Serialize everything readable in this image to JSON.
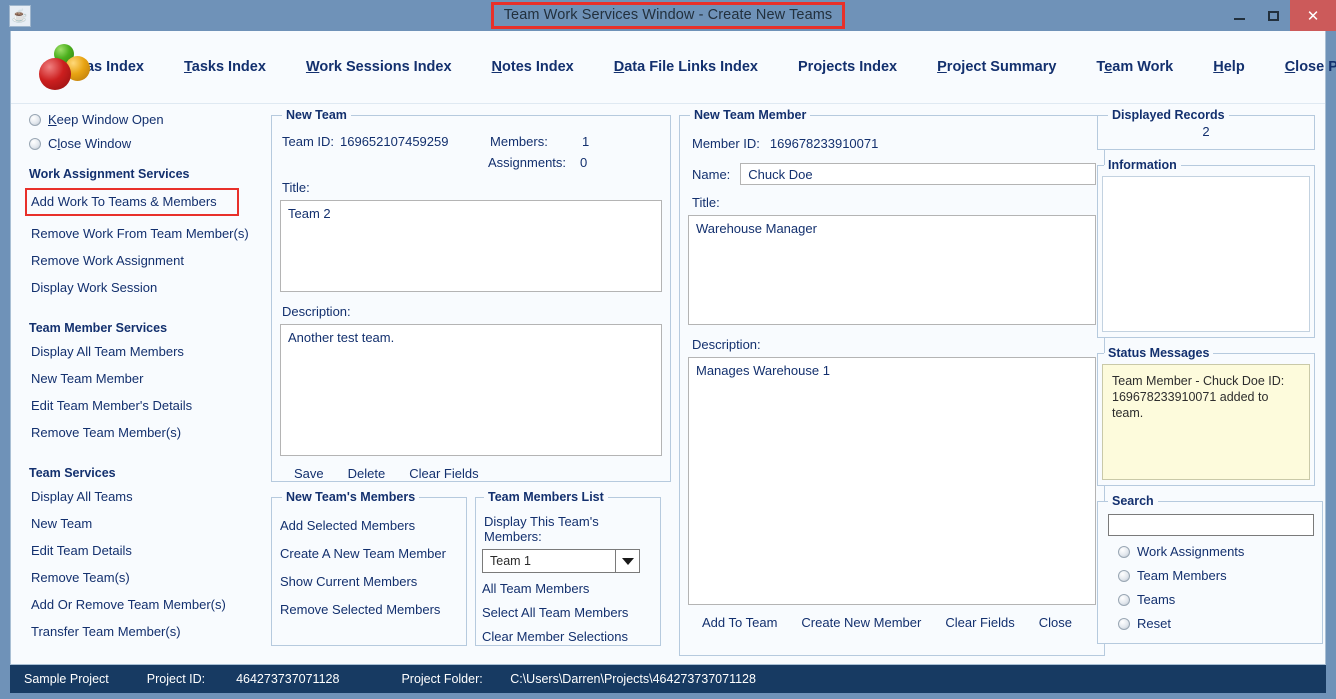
{
  "window": {
    "title": "Team Work Services Window - Create New Teams",
    "app_icon": "java-coffee-cup-icon",
    "minimize": "minimize-icon",
    "maximize": "maximize-icon",
    "close": "✕",
    "highlight_color": "#e8302a",
    "titlebar_color": "#6f92b8",
    "close_button_color": "#cc5a5a"
  },
  "menu": {
    "items": [
      {
        "label": "Ideas Index",
        "mnemonic": "I"
      },
      {
        "label": "Tasks Index",
        "mnemonic": "T"
      },
      {
        "label": "Work Sessions Index",
        "mnemonic": "W"
      },
      {
        "label": "Notes Index",
        "mnemonic": "N"
      },
      {
        "label": "Data File Links Index",
        "mnemonic": "D"
      },
      {
        "label": "Projects Index",
        "mnemonic": ""
      },
      {
        "label": "Project Summary",
        "mnemonic": "P"
      },
      {
        "label": "Team Work",
        "mnemonic": "e"
      },
      {
        "label": "Help",
        "mnemonic": "H"
      },
      {
        "label": "Close Program",
        "mnemonic": "C"
      }
    ]
  },
  "sidebar": {
    "radios": [
      {
        "label": "Keep Window Open",
        "selected": false
      },
      {
        "label": "Close Window",
        "selected": false
      }
    ],
    "groups": [
      {
        "title": "Work Assignment Services",
        "items": [
          {
            "label": "Add Work To Teams & Members",
            "highlighted": true
          },
          {
            "label": "Remove Work From Team Member(s)",
            "highlighted": false
          },
          {
            "label": "Remove Work Assignment",
            "highlighted": false
          },
          {
            "label": "Display Work Session",
            "highlighted": false
          }
        ]
      },
      {
        "title": "Team Member Services",
        "items": [
          {
            "label": "Display All Team Members",
            "highlighted": false
          },
          {
            "label": "New Team Member",
            "highlighted": false
          },
          {
            "label": "Edit Team Member's Details",
            "highlighted": false
          },
          {
            "label": "Remove Team Member(s)",
            "highlighted": false
          }
        ]
      },
      {
        "title": "Team Services",
        "items": [
          {
            "label": "Display All Teams",
            "highlighted": false
          },
          {
            "label": "New Team",
            "highlighted": false
          },
          {
            "label": "Edit Team Details",
            "highlighted": false
          },
          {
            "label": "Remove Team(s)",
            "highlighted": false
          },
          {
            "label": "Add Or Remove Team Member(s)",
            "highlighted": false
          },
          {
            "label": "Transfer Team Member(s)",
            "highlighted": false
          }
        ]
      }
    ]
  },
  "new_team": {
    "legend": "New Team",
    "team_id_label": "Team ID:",
    "team_id_value": "169652107459259",
    "members_label": "Members:",
    "members_value": "1",
    "assignments_label": "Assignments:",
    "assignments_value": "0",
    "title_label": "Title:",
    "title_value": "Team 2",
    "description_label": "Description:",
    "description_value": "Another test team.",
    "buttons": [
      "Save",
      "Delete",
      "Clear Fields"
    ]
  },
  "new_teams_members": {
    "legend": "New Team's Members",
    "items": [
      "Add Selected Members",
      "Create A New Team Member",
      "Show Current Members",
      "Remove Selected Members"
    ]
  },
  "team_members_list": {
    "legend": "Team Members List",
    "combo_label": "Display This Team's Members:",
    "combo_value": "Team 1",
    "combo_icon": "chevron-down-icon",
    "items": [
      "All Team Members",
      "Select All Team Members",
      "Clear Member Selections"
    ]
  },
  "new_team_member": {
    "legend": "New Team Member",
    "member_id_label": "Member ID:",
    "member_id_value": "169678233910071",
    "name_label": "Name:",
    "name_value": "Chuck Doe",
    "title_label": "Title:",
    "title_value": "Warehouse Manager",
    "description_label": "Description:",
    "description_value": "Manages Warehouse 1",
    "buttons": [
      "Add To Team",
      "Create New Member",
      "Clear Fields",
      "Close"
    ]
  },
  "displayed_records": {
    "legend": "Displayed Records",
    "value": "2"
  },
  "information": {
    "legend": "Information",
    "value": ""
  },
  "status_messages": {
    "legend": "Status Messages",
    "value": "Team Member - Chuck Doe ID: 169678233910071 added to team.",
    "background": "#fdfbdc"
  },
  "search": {
    "legend": "Search",
    "input_value": "",
    "input_placeholder": "",
    "options": [
      {
        "label": "Work Assignments",
        "selected": false
      },
      {
        "label": "Team Members",
        "selected": false
      },
      {
        "label": "Teams",
        "selected": false
      },
      {
        "label": "Reset",
        "selected": false
      }
    ]
  },
  "statusbar": {
    "project_name": "Sample Project",
    "project_id_label": "Project ID:",
    "project_id_value": "464273737071128",
    "project_folder_label": "Project Folder:",
    "project_folder_value": "C:\\Users\\Darren\\Projects\\464273737071128"
  }
}
